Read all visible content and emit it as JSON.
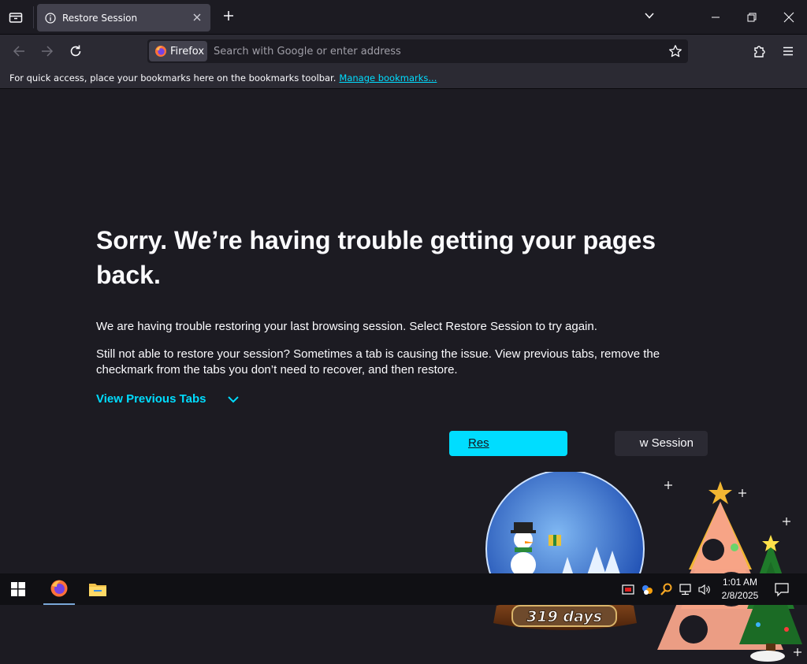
{
  "tabs": [
    {
      "title": "Restore Session",
      "icon": "info-icon",
      "active": true
    }
  ],
  "navbar": {
    "identity_label": "Firefox",
    "url_placeholder": "Search with Google or enter address",
    "url_value": ""
  },
  "bookmarks_toolbar": {
    "message": "For quick access, place your bookmarks here on the bookmarks toolbar.",
    "link": "Manage bookmarks..."
  },
  "content": {
    "title": "Sorry. We’re having trouble getting your pages back.",
    "paragraph1": "We are having trouble restoring your last browsing session. Select Restore Session to try again.",
    "paragraph2": "Still not able to restore your session? Sometimes a tab is causing the issue. View previous tabs, remove the checkmark from the tabs you don’t need to recover, and then restore.",
    "view_previous_tabs": "View Previous Tabs",
    "restore_button": "Res",
    "new_session_button": "w Session"
  },
  "decorations": {
    "snowglobe_label": "319 days"
  },
  "taskbar": {
    "time": "1:01 AM",
    "date": "2/8/2025",
    "apps": [
      "firefox-icon",
      "file-explorer-icon"
    ]
  },
  "colors": {
    "accent": "#00ddff",
    "background": "#1c1b22",
    "toolbar": "#2b2a33",
    "tab_active": "#42414d"
  }
}
